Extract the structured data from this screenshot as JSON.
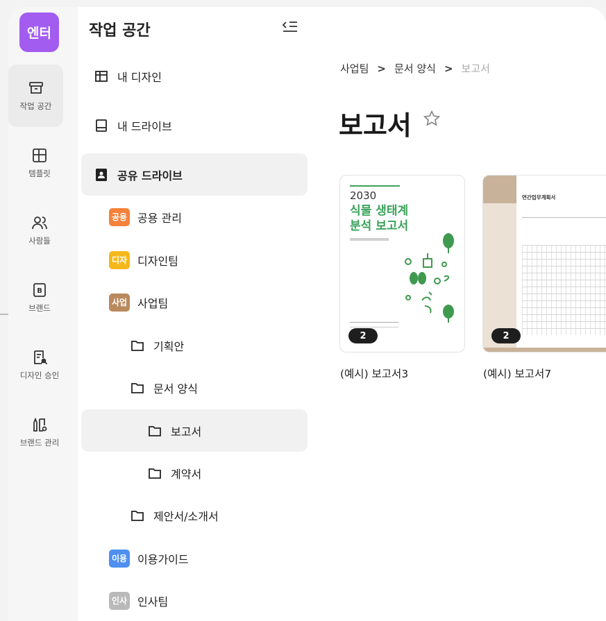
{
  "app": {
    "logo_text": "엔터"
  },
  "rail": {
    "items": [
      {
        "label": "작업 공간",
        "icon": "archive-icon"
      },
      {
        "label": "템플릿",
        "icon": "layout-icon"
      },
      {
        "label": "사람들",
        "icon": "people-icon"
      },
      {
        "label": "브랜드",
        "icon": "brand-icon"
      },
      {
        "label": "디자인 승인",
        "icon": "approval-icon"
      },
      {
        "label": "브랜드 관리",
        "icon": "brand-manage-icon"
      }
    ]
  },
  "panel": {
    "title": "작업 공간",
    "items": [
      {
        "label": "내 디자인",
        "icon": "grid-icon"
      },
      {
        "label": "내 드라이브",
        "icon": "drive-icon"
      },
      {
        "label": "공유 드라이브",
        "icon": "shared-drive-icon"
      },
      {
        "label": "공용 관리",
        "badge": "공용",
        "color": "#f4823a"
      },
      {
        "label": "디자인팀",
        "badge": "디자",
        "color": "#f5b81c"
      },
      {
        "label": "사업팀",
        "badge": "사업",
        "color": "#b98a5e"
      },
      {
        "label": "기획안",
        "icon": "folder-icon"
      },
      {
        "label": "문서 양식",
        "icon": "folder-icon"
      },
      {
        "label": "보고서",
        "icon": "folder-icon"
      },
      {
        "label": "계약서",
        "icon": "folder-icon"
      },
      {
        "label": "제안서/소개서",
        "icon": "folder-icon"
      },
      {
        "label": "이용가이드",
        "badge": "이용",
        "color": "#4e8ff0"
      },
      {
        "label": "인사팀",
        "badge": "인사",
        "color": "#b9b9b9"
      }
    ]
  },
  "breadcrumb": {
    "items": [
      "사업팀",
      "문서 양식"
    ],
    "separator": ">",
    "current": "보고서"
  },
  "page": {
    "title": "보고서"
  },
  "cards": [
    {
      "label": "(예시) 보고서3",
      "count": "2",
      "thumb": {
        "year": "2030",
        "line1": "식물 생태계",
        "line2": "분석 보고서"
      }
    },
    {
      "label": "(예시) 보고서7",
      "count": "2",
      "thumb": {
        "heading": "연간업무계획서"
      }
    }
  ]
}
